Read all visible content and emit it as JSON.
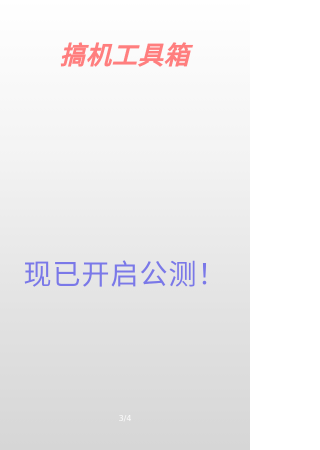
{
  "app": {
    "title": "搞机工具箱"
  },
  "main": {
    "headline": "现已开启公测！"
  },
  "pager": {
    "indicator": "3/4"
  },
  "colors": {
    "title": "#ff7e7e",
    "headline": "#7a78e8",
    "background_top": "#ffffff",
    "background_bottom": "#d6d6d6"
  }
}
